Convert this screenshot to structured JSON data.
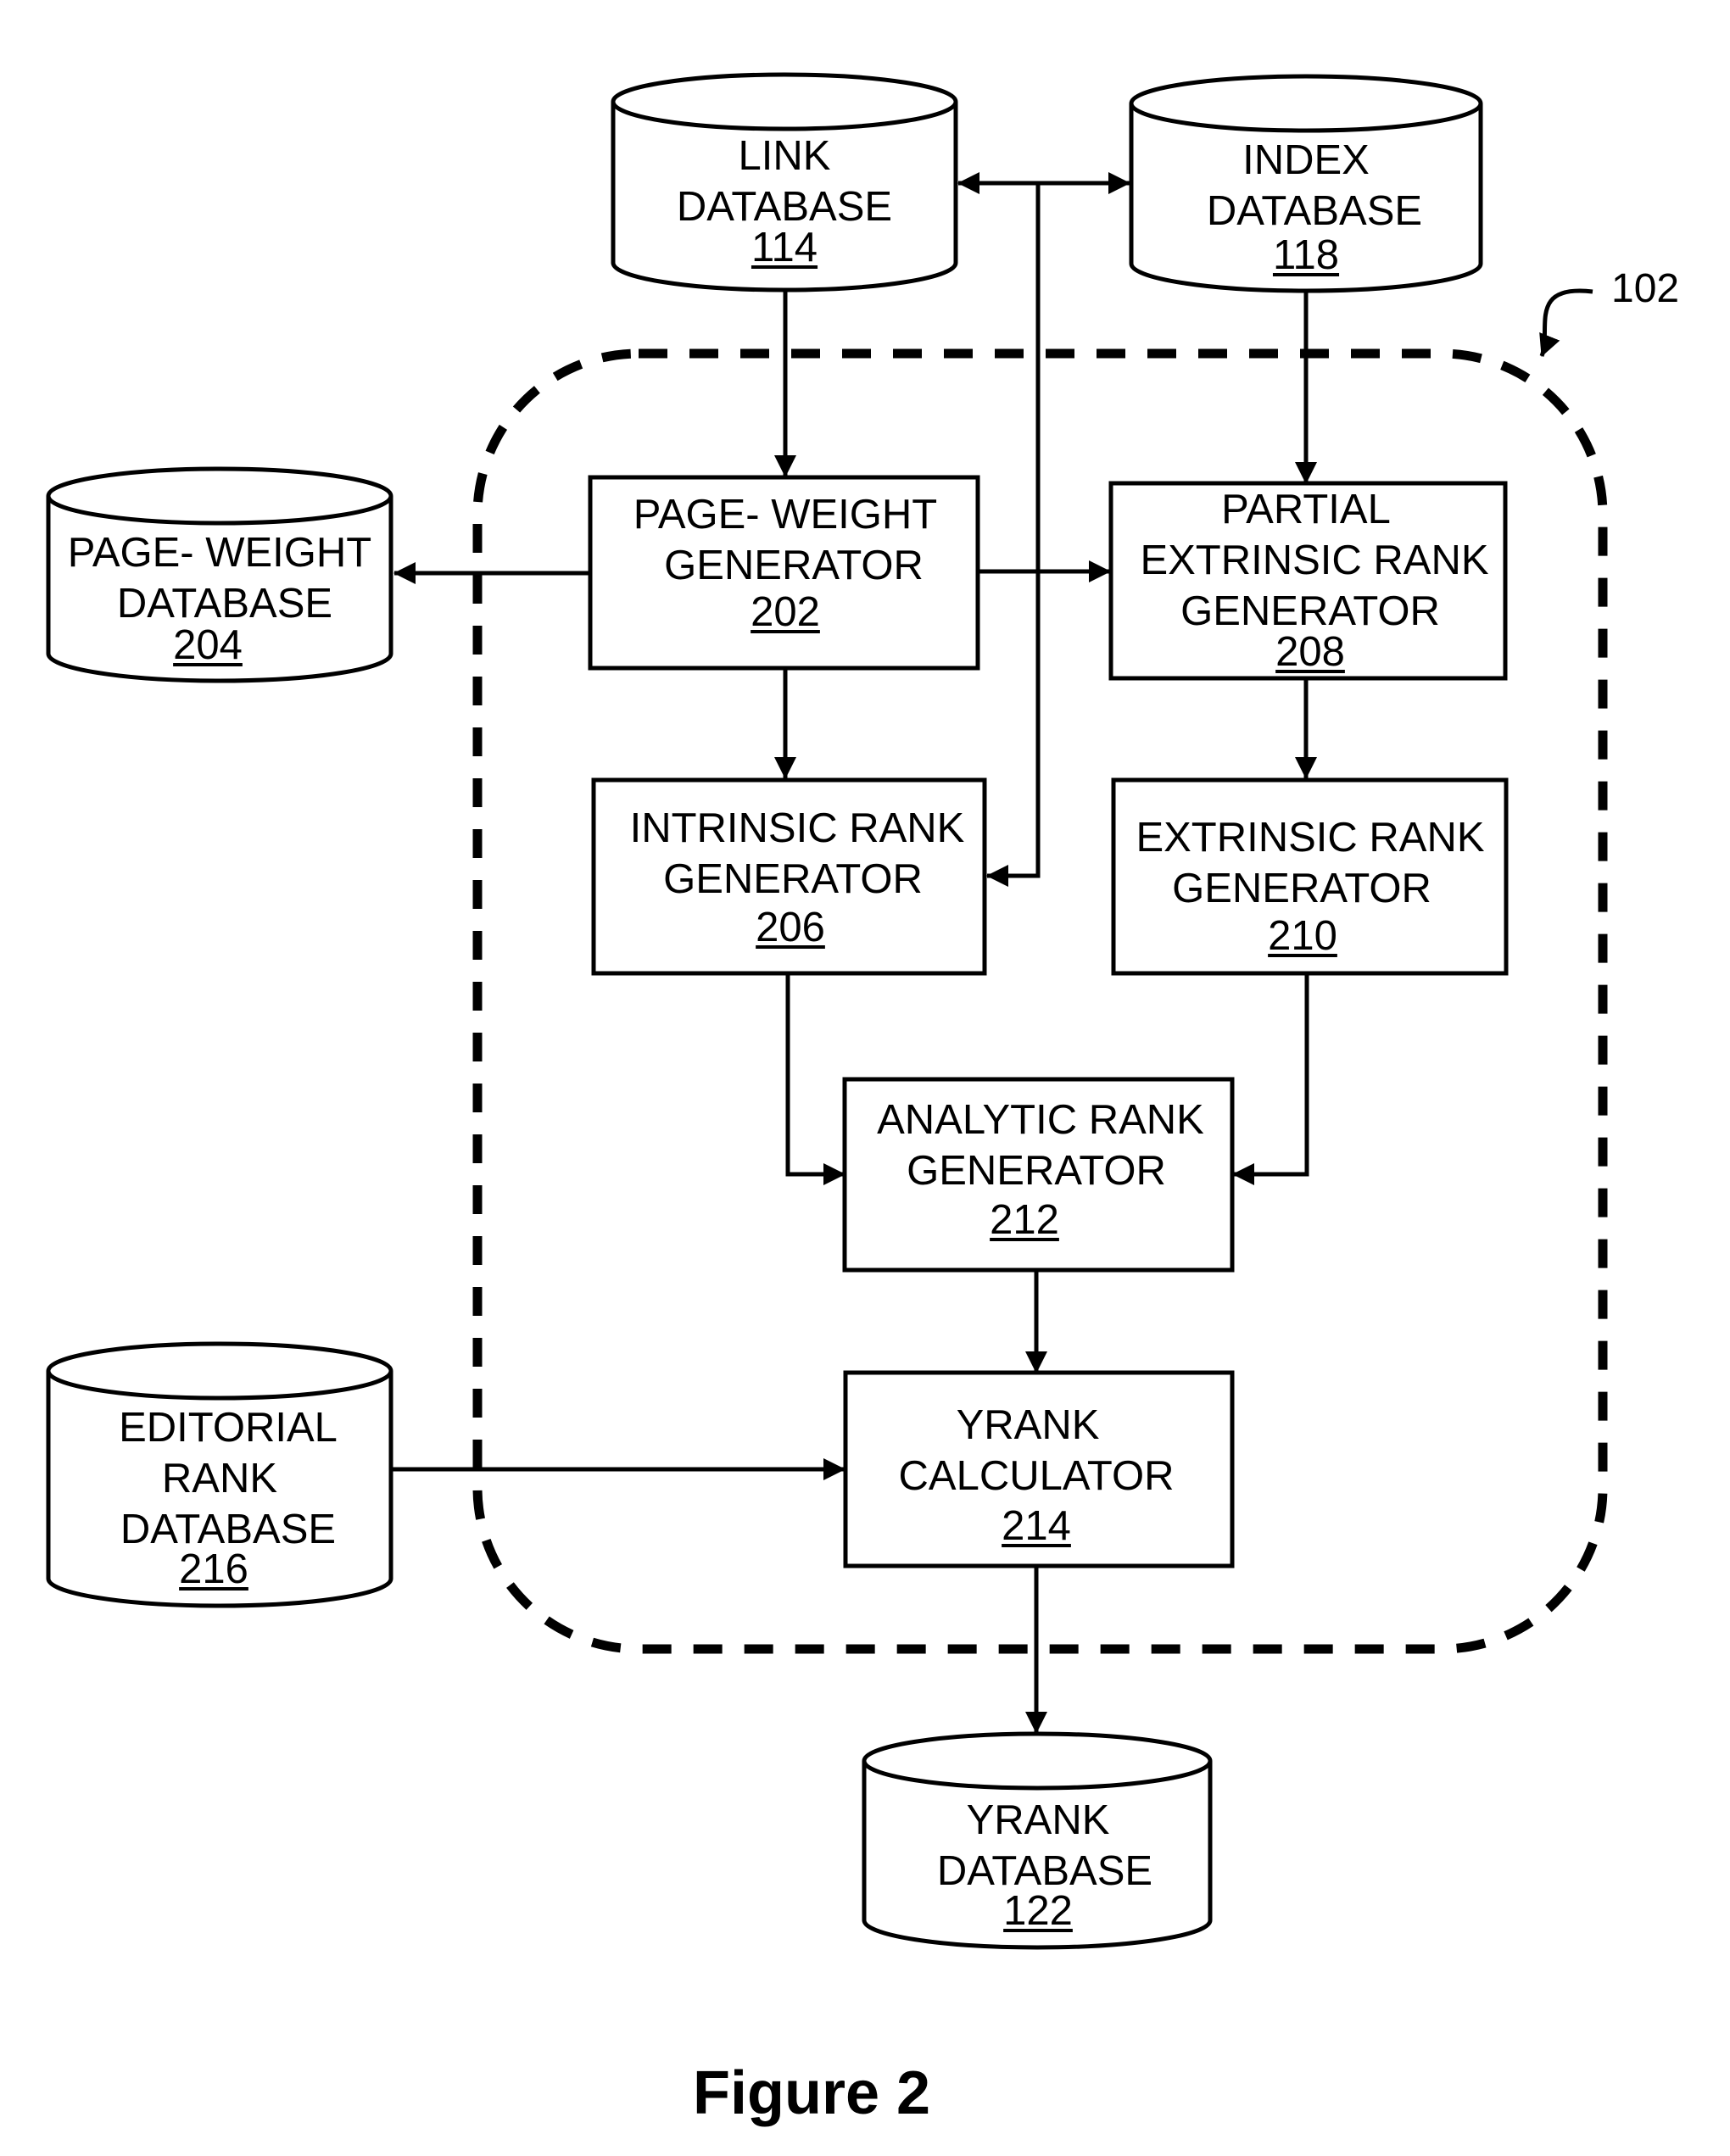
{
  "figure": {
    "caption": "Figure 2",
    "system_callout": "102",
    "colors": {
      "ink": "#000000",
      "background": "#ffffff"
    }
  },
  "databases": {
    "link": {
      "lines": [
        "LINK",
        "DATABASE"
      ],
      "ref": "114"
    },
    "index": {
      "lines": [
        "INDEX",
        "DATABASE"
      ],
      "ref": "118"
    },
    "page_weight": {
      "lines": [
        "PAGE- WEIGHT",
        "DATABASE"
      ],
      "ref": "204"
    },
    "editorial_rank": {
      "lines": [
        "EDITORIAL",
        "RANK",
        "DATABASE"
      ],
      "ref": "216"
    },
    "yrank": {
      "lines": [
        "YRANK",
        "DATABASE"
      ],
      "ref": "122"
    }
  },
  "modules": {
    "page_weight_generator": {
      "lines": [
        "PAGE- WEIGHT",
        "GENERATOR"
      ],
      "ref": "202"
    },
    "partial_extrinsic_rank_generator": {
      "lines": [
        "PARTIAL",
        "EXTRINSIC RANK",
        "GENERATOR"
      ],
      "ref": "208"
    },
    "intrinsic_rank_generator": {
      "lines": [
        "INTRINSIC RANK",
        "GENERATOR"
      ],
      "ref": "206"
    },
    "extrinsic_rank_generator": {
      "lines": [
        "EXTRINSIC RANK",
        "GENERATOR"
      ],
      "ref": "210"
    },
    "analytic_rank_generator": {
      "lines": [
        "ANALYTIC RANK",
        "GENERATOR"
      ],
      "ref": "212"
    },
    "yrank_calculator": {
      "lines": [
        "YRANK",
        "CALCULATOR"
      ],
      "ref": "214"
    }
  },
  "connections": [
    {
      "from": "link",
      "to": "index",
      "type": "bidirectional"
    },
    {
      "from": "link",
      "to": "page_weight_generator",
      "type": "arrow"
    },
    {
      "from": "index",
      "to": "partial_extrinsic_rank_generator",
      "type": "arrow"
    },
    {
      "from": "link/index bus",
      "to": "intrinsic_rank_generator",
      "type": "arrow"
    },
    {
      "from": "page_weight_generator",
      "to": "page_weight",
      "type": "arrow"
    },
    {
      "from": "page_weight_generator",
      "to": "partial_extrinsic_rank_generator",
      "type": "arrow"
    },
    {
      "from": "page_weight_generator",
      "to": "intrinsic_rank_generator",
      "type": "arrow"
    },
    {
      "from": "partial_extrinsic_rank_generator",
      "to": "extrinsic_rank_generator",
      "type": "arrow"
    },
    {
      "from": "intrinsic_rank_generator",
      "to": "analytic_rank_generator",
      "type": "arrow"
    },
    {
      "from": "extrinsic_rank_generator",
      "to": "analytic_rank_generator",
      "type": "arrow"
    },
    {
      "from": "analytic_rank_generator",
      "to": "yrank_calculator",
      "type": "arrow"
    },
    {
      "from": "editorial_rank",
      "to": "yrank_calculator",
      "type": "arrow"
    },
    {
      "from": "yrank_calculator",
      "to": "yrank",
      "type": "arrow"
    }
  ]
}
